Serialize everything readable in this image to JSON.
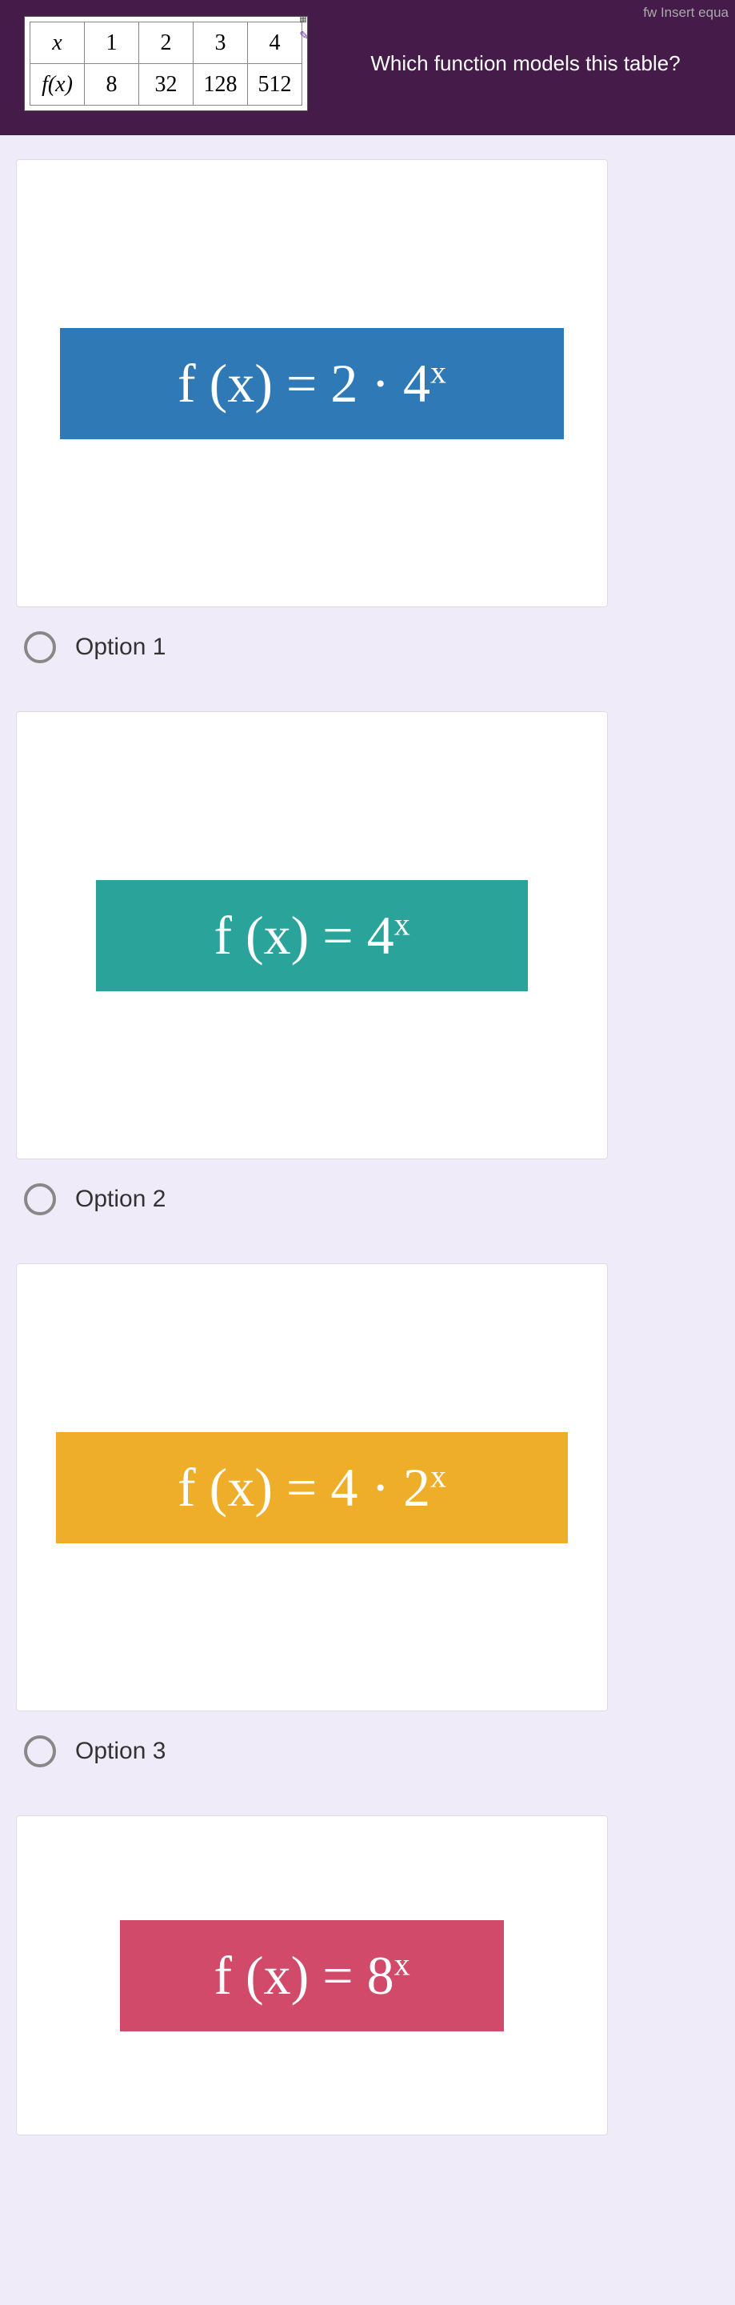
{
  "header": {
    "insert_equation": "fw Insert equa",
    "question": "Which function models this table?",
    "table": {
      "row1": [
        "x",
        "1",
        "2",
        "3",
        "4"
      ],
      "row2": [
        "f(x)",
        "8",
        "32",
        "128",
        "512"
      ]
    }
  },
  "options": {
    "opt1": {
      "formula": "f (x) = 2 · 4",
      "exp": "x",
      "label": "Option 1"
    },
    "opt2": {
      "formula": "f (x) = 4",
      "exp": "x",
      "label": "Option 2"
    },
    "opt3": {
      "formula": "f (x) = 4 · 2",
      "exp": "x",
      "label": "Option 3"
    },
    "opt4": {
      "formula": "f (x) = 8",
      "exp": "x",
      "label": ""
    }
  }
}
